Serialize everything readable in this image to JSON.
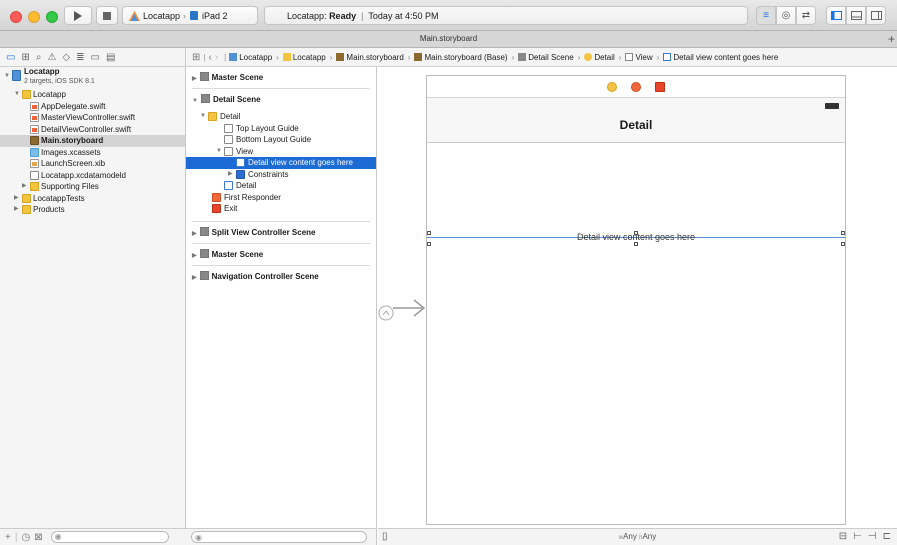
{
  "toolbar": {
    "scheme": "Locatapp",
    "device": "iPad 2",
    "status_app": "Locatapp:",
    "status_state": "Ready",
    "status_time": "Today at 4:50 PM"
  },
  "tab": {
    "title": "Main.storyboard",
    "plus": "+"
  },
  "navigator": {
    "project_name": "Locatapp",
    "project_sub": "2 targets, iOS SDK 8.1",
    "items": [
      {
        "label": "Locatapp",
        "icon": "folder-icon"
      },
      {
        "label": "AppDelegate.swift",
        "icon": "swift-file-icon"
      },
      {
        "label": "MasterViewController.swift",
        "icon": "swift-file-icon"
      },
      {
        "label": "DetailViewController.swift",
        "icon": "swift-file-icon"
      },
      {
        "label": "Main.storyboard",
        "icon": "storyboard-icon",
        "selected": true
      },
      {
        "label": "Images.xcassets",
        "icon": "assets-icon"
      },
      {
        "label": "LaunchScreen.xib",
        "icon": "xib-icon"
      },
      {
        "label": "Locatapp.xcdatamodeld",
        "icon": "datamodel-icon"
      },
      {
        "label": "Supporting Files",
        "icon": "folder-icon"
      },
      {
        "label": "LocatappTests",
        "icon": "folder-icon"
      },
      {
        "label": "Products",
        "icon": "folder-icon"
      }
    ]
  },
  "jumpbar": {
    "crumbs": [
      "Locatapp",
      "Locatapp",
      "Main.storyboard",
      "Main.storyboard (Base)",
      "Detail Scene",
      "Detail",
      "View",
      "Detail view content goes here"
    ]
  },
  "outline": {
    "master_scene": "Master Scene",
    "detail_scene": "Detail Scene",
    "detail": "Detail",
    "top_layout": "Top Layout Guide",
    "bottom_layout": "Bottom Layout Guide",
    "view": "View",
    "content_label": "Detail view content goes here",
    "constraints": "Constraints",
    "detail_back": "Detail",
    "first_responder": "First Responder",
    "exit": "Exit",
    "split_scene": "Split View Controller Scene",
    "master_scene2": "Master Scene",
    "nav_scene": "Navigation Controller Scene"
  },
  "canvas": {
    "nav_title": "Detail",
    "content_text": "Detail view content goes here",
    "size_w": "w",
    "size_any1": "Any",
    "size_h": "h",
    "size_any2": "Any"
  },
  "colors": {
    "selection_blue": "#1c6ad3",
    "accent": "#1b74e6"
  }
}
